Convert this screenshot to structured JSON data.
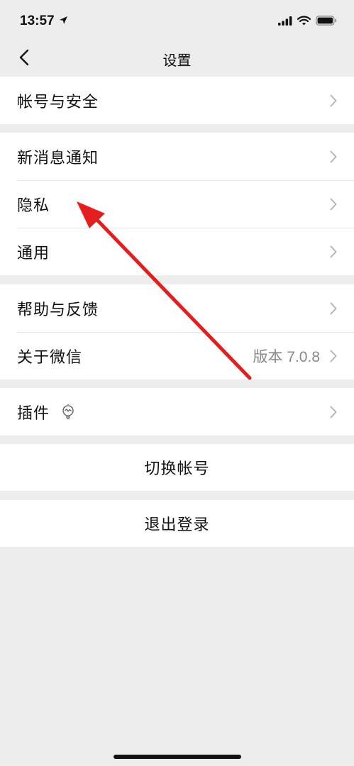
{
  "status_bar": {
    "time": "13:57",
    "icons": [
      "location-arrow-icon",
      "cellular-signal-icon",
      "wifi-icon",
      "battery-icon"
    ]
  },
  "nav": {
    "title": "设置",
    "back_icon": "chevron-left-icon"
  },
  "groups": [
    {
      "items": [
        {
          "label": "帐号与安全",
          "value": ""
        }
      ]
    },
    {
      "items": [
        {
          "label": "新消息通知",
          "value": ""
        },
        {
          "label": "隐私",
          "value": ""
        },
        {
          "label": "通用",
          "value": ""
        }
      ]
    },
    {
      "items": [
        {
          "label": "帮助与反馈",
          "value": ""
        },
        {
          "label": "关于微信",
          "value": "版本 7.0.8"
        }
      ]
    },
    {
      "items": [
        {
          "label": "插件",
          "value": "",
          "icon": "lightbulb-icon"
        }
      ]
    }
  ],
  "actions": {
    "switch_account": "切换帐号",
    "logout": "退出登录"
  },
  "annotation": {
    "type": "red-arrow",
    "color": "#e41e1e",
    "points_to": "隐私"
  },
  "colors": {
    "background": "#ededed",
    "cell_background": "#ffffff",
    "secondary_text": "#888888",
    "chevron": "#b2b2b2"
  }
}
